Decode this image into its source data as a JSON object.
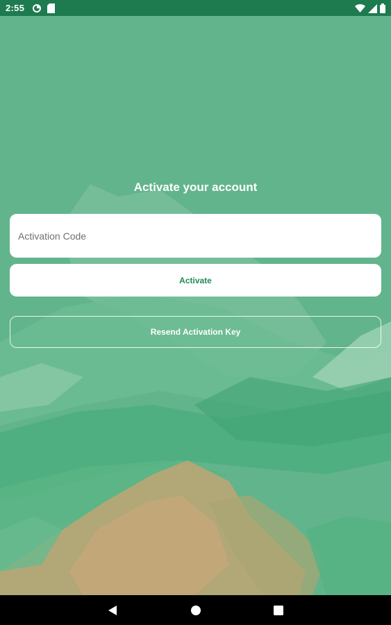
{
  "status_bar": {
    "time": "2:55",
    "left_icons": [
      "app-notification-icon",
      "sd-card-icon"
    ],
    "right_icons": [
      "wifi-icon",
      "cell-signal-icon",
      "battery-icon"
    ]
  },
  "main": {
    "title": "Activate your account",
    "activation_input": {
      "value": "",
      "placeholder": "Activation Code"
    },
    "activate_button": "Activate",
    "resend_button": "Resend Activation Key"
  },
  "nav_bar": {
    "buttons": [
      "back-icon",
      "home-icon",
      "recents-icon"
    ]
  },
  "colors": {
    "status_bar": "#1e7a4f",
    "background": "#62b48c",
    "accent_text": "#1f8a5a",
    "nav_bar": "#000000"
  }
}
